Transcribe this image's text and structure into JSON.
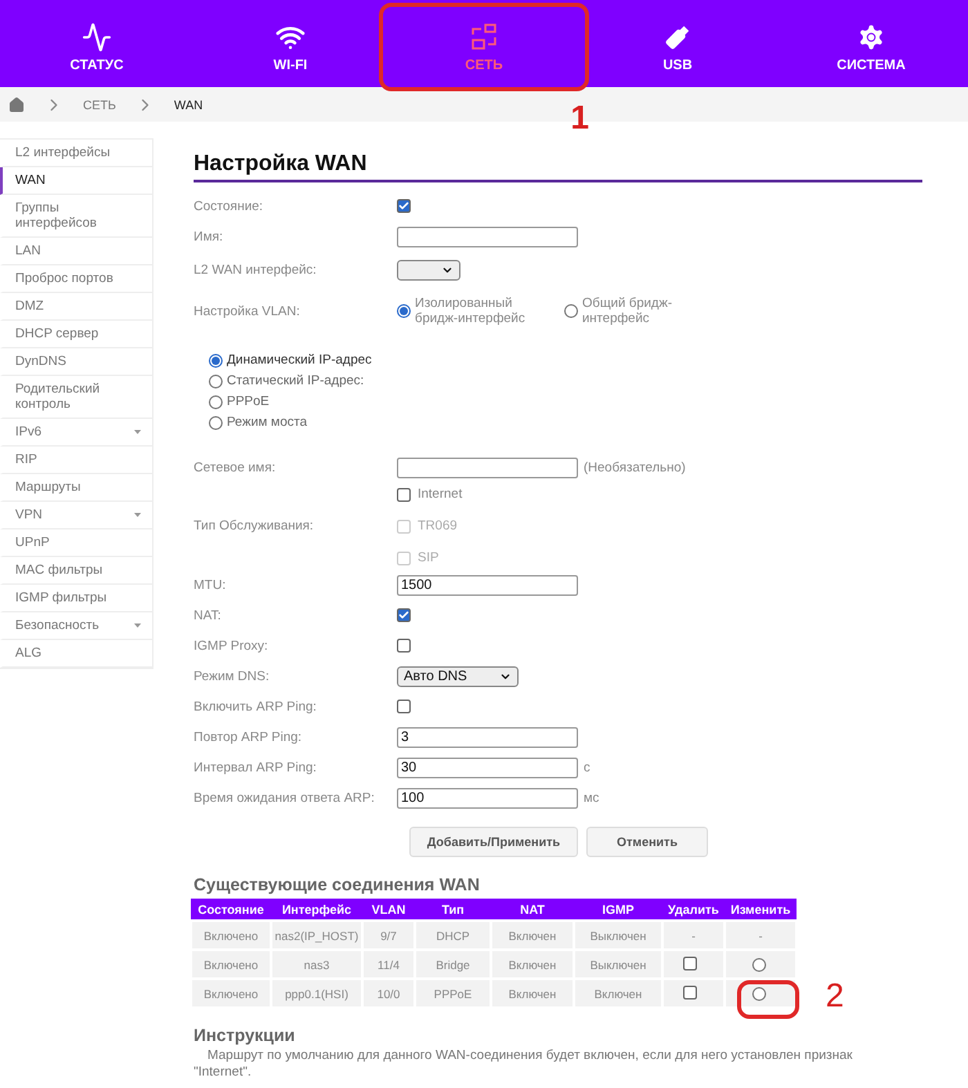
{
  "nav": [
    {
      "label": "СТАТУС",
      "selected": false
    },
    {
      "label": "WI-FI",
      "selected": false
    },
    {
      "label": "СЕТЬ",
      "selected": true,
      "annotation": "1"
    },
    {
      "label": "USB",
      "selected": false
    },
    {
      "label": "СИСТЕМА",
      "selected": false
    }
  ],
  "breadcrumb": [
    "СЕТЬ",
    "WAN"
  ],
  "sidebar": {
    "items": [
      {
        "label": "L2 интерфейсы",
        "selected": false,
        "expandable": false
      },
      {
        "label": "WAN",
        "selected": true,
        "expandable": false
      },
      {
        "label": "Группы интерфейсов",
        "selected": false,
        "expandable": false
      },
      {
        "label": "LAN",
        "selected": false,
        "expandable": false
      },
      {
        "label": "Проброс портов",
        "selected": false,
        "expandable": false
      },
      {
        "label": "DMZ",
        "selected": false,
        "expandable": false
      },
      {
        "label": "DHCP сервер",
        "selected": false,
        "expandable": false
      },
      {
        "label": "DynDNS",
        "selected": false,
        "expandable": false
      },
      {
        "label": "Родительский контроль",
        "selected": false,
        "expandable": false
      },
      {
        "label": "IPv6",
        "selected": false,
        "expandable": true
      },
      {
        "label": "RIP",
        "selected": false,
        "expandable": false
      },
      {
        "label": "Маршруты",
        "selected": false,
        "expandable": false
      },
      {
        "label": "VPN",
        "selected": false,
        "expandable": true
      },
      {
        "label": "UPnP",
        "selected": false,
        "expandable": false
      },
      {
        "label": "MAC фильтры",
        "selected": false,
        "expandable": false
      },
      {
        "label": "IGMP фильтры",
        "selected": false,
        "expandable": false
      },
      {
        "label": "Безопасность",
        "selected": false,
        "expandable": true
      },
      {
        "label": "ALG",
        "selected": false,
        "expandable": false
      }
    ]
  },
  "form": {
    "title": "Настройка WAN",
    "fields": [
      {
        "kind": "checkbox",
        "label": "Состояние:",
        "checked": true
      },
      {
        "kind": "text",
        "label": "Имя:"
      },
      {
        "kind": "select",
        "label": "L2 WAN интерфейс:"
      },
      {
        "kind": "radios",
        "label": "Настройка VLAN:",
        "options": [
          {
            "label": "Изолированный бридж-интерфейс",
            "selected": true
          },
          {
            "label": "Общий бридж-интерфейс",
            "selected": false
          }
        ]
      },
      {
        "kind": "radiolist",
        "options": [
          {
            "label": "Динамический IP-адрес",
            "selected": true
          },
          {
            "label": "Статический IP-адрес:",
            "selected": false
          },
          {
            "label": "PPPoE",
            "selected": false
          },
          {
            "label": "Режим моста",
            "selected": false
          }
        ]
      },
      {
        "kind": "text",
        "label": "Сетевое имя:",
        "suffix": "(Необязательно)"
      },
      {
        "kind": "checkgroup",
        "label": "Тип Обслуживания:",
        "options": [
          {
            "label": "Internet",
            "checked": false,
            "disabled": false
          },
          {
            "label": "TR069",
            "checked": false,
            "disabled": true
          },
          {
            "label": "SIP",
            "checked": false,
            "disabled": true
          }
        ]
      },
      {
        "kind": "text",
        "label": "MTU:",
        "value": "1500"
      },
      {
        "kind": "checkbox",
        "label": "NAT:",
        "checked": true
      },
      {
        "kind": "checkbox",
        "label": "IGMP Proxy:",
        "checked": false
      },
      {
        "kind": "select",
        "label": "Режим DNS:",
        "value": "Авто DNS"
      },
      {
        "kind": "checkbox",
        "label": "Включить ARP Ping:",
        "checked": false
      },
      {
        "kind": "text",
        "label": "Повтор ARP Ping:",
        "value": "3"
      },
      {
        "kind": "text",
        "label": "Интервал ARP Ping:",
        "value": "30",
        "suffix": "с"
      },
      {
        "kind": "text",
        "label": "Время ожидания ответа ARP:",
        "value": "100",
        "suffix": "мс"
      }
    ],
    "buttons": [
      "Добавить/Применить",
      "Отменить"
    ]
  },
  "connections": {
    "title": "Существующие соединения WAN",
    "columns": [
      "Состояние",
      "Интерфейс",
      "VLAN",
      "Тип",
      "NAT",
      "IGMP",
      "Удалить",
      "Изменить"
    ],
    "rows": [
      {
        "cells": [
          "Включено",
          "nas2(IP_HOST)",
          "9/7",
          "DHCP",
          "Включен",
          "Выключен"
        ],
        "delete": {
          "kind": "text",
          "text": "-"
        },
        "edit": {
          "kind": "text",
          "text": "-"
        }
      },
      {
        "cells": [
          "Включено",
          "nas3",
          "11/4",
          "Bridge",
          "Включен",
          "Выключен"
        ],
        "delete": {
          "kind": "checkbox",
          "checked": false
        },
        "edit": {
          "kind": "radio",
          "selected": false
        }
      },
      {
        "cells": [
          "Включено",
          "ppp0.1(HSI)",
          "10/0",
          "PPPoE",
          "Включен",
          "Включен"
        ],
        "delete": {
          "kind": "checkbox",
          "checked": false
        },
        "edit": {
          "kind": "radio",
          "selected": false
        },
        "annotation": "2"
      }
    ]
  },
  "instructions": {
    "title": "Инструкции",
    "text": "Маршрут по умолчанию для данного WAN-соединения будет включен, если для него установлен признак \"Internet\"."
  }
}
